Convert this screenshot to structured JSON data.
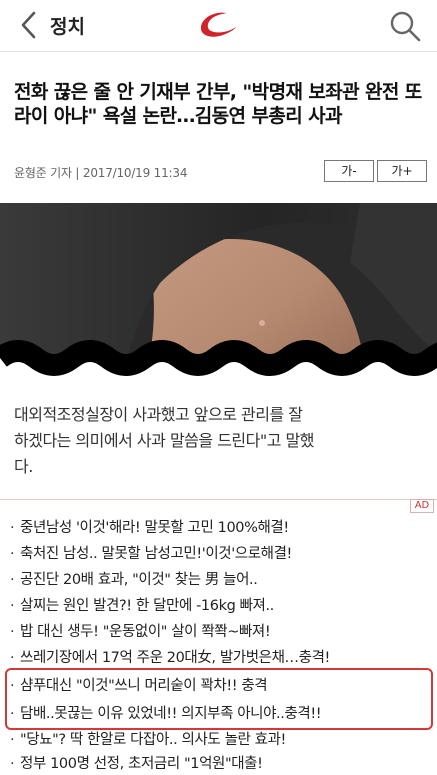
{
  "header": {
    "section_title": "정치",
    "back_icon": "chevron-left-icon",
    "search_icon": "search-icon",
    "brand_color": "#d0242b"
  },
  "article": {
    "headline": "전화 끊은 줄 안 기재부 간부, \"박명재 보좌관 완전 또라이 아냐\" 욕설 논란…김동연 부총리 사과",
    "byline": "윤형준 기자 | 2017/10/19 11:34",
    "font_decrease_label": "가-",
    "font_increase_label": "가+",
    "body_line_1": "대외적조정실장이 사과했고 앞으로 관리를 잘",
    "body_line_2": "하겠다는 의미에서 사과 말씀을 드린다\"고 말했",
    "body_line_3": "다."
  },
  "ads": {
    "badge": "AD",
    "highlight_color": "#d23a3a",
    "items": [
      "중년남성 '이것'해라! 말못할 고민 100%해결!",
      "축처진 남성.. 말못할 남성고민!'이것'으로해결!",
      "공진단 20배 효과, \"이것\" 찾는 男 늘어..",
      "살찌는 원인 발견?! 한 달만에 -16kg 빠져..",
      "밥 대신 생두! \"운동없이\" 살이 쫙쫙~빠져!",
      "쓰레기장에서 17억 주운 20대女, 발가벗은채…충격!",
      "샴푸대신 \"이것\"쓰니 머리숱이 꽉차!! 충격",
      "담배..못끊는 이유 있었네!! 의지부족 아니야..충격!!",
      "\"당뇨\"? 딱 한알로 다잡아.. 의사도 놀란 효과!",
      "정부 100명 선정, 초저금리 \"1억원\"대출!"
    ]
  }
}
